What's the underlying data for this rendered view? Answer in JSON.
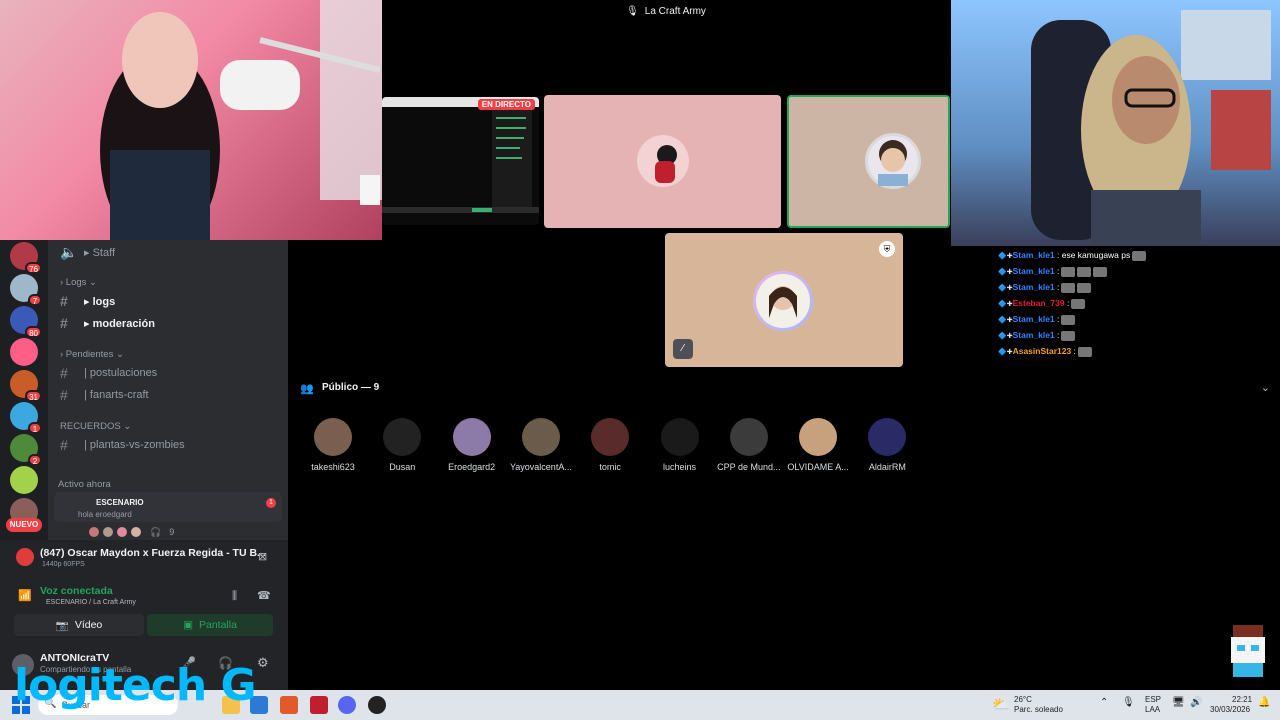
{
  "stage": {
    "title": "La Craft Army",
    "live_badge": "EN DIRECTO",
    "audience_label": "Público — 9",
    "audience": [
      {
        "name": "takeshi623",
        "color": "#7a5f50"
      },
      {
        "name": "Dusan",
        "color": "#222222"
      },
      {
        "name": "Eroedgard2",
        "color": "#8c7aa8"
      },
      {
        "name": "YayovalcentA...",
        "color": "#6b5b4a"
      },
      {
        "name": "tomic",
        "color": "#5a2b2b"
      },
      {
        "name": "lucheins",
        "color": "#1a1a1a"
      },
      {
        "name": "CPP de Mund...",
        "color": "#3b3b3b"
      },
      {
        "name": "OLVIDAME A...",
        "color": "#c7a07d"
      },
      {
        "name": "AldairRM",
        "color": "#2a2a66"
      }
    ]
  },
  "sidebar": {
    "servers": [
      {
        "badge": "76",
        "color": "#b03a48"
      },
      {
        "badge": "7",
        "color": "#9fb8c9"
      },
      {
        "badge": "80",
        "color": "#3b5ab8"
      },
      {
        "badge": "",
        "color": "#ff5f86"
      },
      {
        "badge": "31",
        "color": "#c95d2a"
      },
      {
        "badge": "1",
        "color": "#3ca7e0"
      },
      {
        "badge": "2",
        "color": "#4e8a3a"
      },
      {
        "badge": "",
        "color": "#a2d24a"
      },
      {
        "badge": "3",
        "color": "#8a5f5a"
      }
    ],
    "nuevo": "NUEVO",
    "channels": {
      "staff": "▸ Staff",
      "logs_cat": "› Logs ⌄",
      "logs": "▸ logs",
      "moderacion": "▸ moderación",
      "pendientes_cat": "› Pendientes ⌄",
      "postulaciones": "| postulaciones",
      "fanarts": "| fanarts-craft",
      "recuerdos_cat": "RECUERDOS ⌄",
      "plantas": "| plantas-vs-zombies"
    },
    "activo": "Activo ahora",
    "stage_card": {
      "title": "ESCENARIO",
      "sub": "hola eroedgard",
      "count_badge": "1",
      "listeners": "9"
    }
  },
  "panel": {
    "now_playing": "(847) Oscar Maydon x Fuerza Regida - TU B...",
    "np_sub": "1440p 60FPS",
    "voice_status": "Voz conectada",
    "voice_sub": "ESCENARIO / La Craft Army",
    "video_label": "Vídeo",
    "screen_label": "Pantalla",
    "user_name": "ANTONIcraTV",
    "user_sub": "Compartiendo su pantalla"
  },
  "chat": [
    {
      "user": "Stam_kle1",
      "color": "blue",
      "msg": " : ese kamugawa ps",
      "emotes": 1
    },
    {
      "user": "Stam_kle1",
      "color": "blue",
      "msg": " :",
      "emotes": 3
    },
    {
      "user": "Stam_kle1",
      "color": "blue",
      "msg": " :",
      "emotes": 2
    },
    {
      "user": "Esteban_739",
      "color": "red",
      "msg": " :",
      "emotes": 1
    },
    {
      "user": "Stam_kle1",
      "color": "blue",
      "msg": " :",
      "emotes": 1
    },
    {
      "user": "Stam_kle1",
      "color": "blue",
      "msg": " :",
      "emotes": 1
    },
    {
      "user": "AsasinStar123",
      "color": "orange",
      "msg": " :",
      "emotes": 1
    }
  ],
  "overlay": {
    "logo": "logitech G"
  },
  "taskbar": {
    "search": "Buscar",
    "weather_temp": "26°C",
    "weather_desc": "Parc. soleado",
    "lang1": "ESP",
    "lang2": "LAA",
    "time": "22:21",
    "date": "30/03/2026"
  }
}
